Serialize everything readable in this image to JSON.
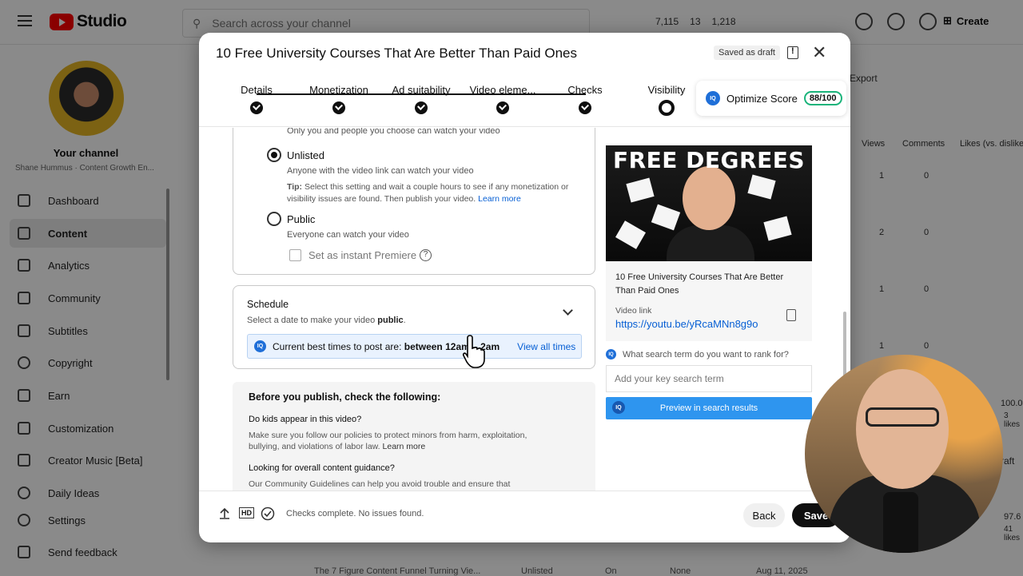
{
  "header": {
    "logo_text": "Studio",
    "search_placeholder": "Search across your channel",
    "stat_views": "7,115",
    "stat_subs": "13",
    "stat_watch": "1,218",
    "create_label": "Create"
  },
  "sidebar": {
    "channel_title": "Your channel",
    "channel_subtitle": "Shane Hummus · Content Growth En...",
    "items": [
      {
        "label": "Dashboard"
      },
      {
        "label": "Content"
      },
      {
        "label": "Analytics"
      },
      {
        "label": "Community"
      },
      {
        "label": "Subtitles"
      },
      {
        "label": "Copyright"
      },
      {
        "label": "Earn"
      },
      {
        "label": "Customization"
      },
      {
        "label": "Creator Music [Beta]"
      },
      {
        "label": "Daily Ideas"
      },
      {
        "label": "Settings"
      },
      {
        "label": "Send feedback"
      }
    ]
  },
  "background": {
    "export_label": "Export",
    "col_views": "Views",
    "col_comments": "Comments",
    "col_likes": "Likes (vs. dislikes)",
    "row_values": [
      "1",
      "0",
      "2",
      "0",
      "1",
      "0",
      "1",
      "0"
    ],
    "pct_1": "100.0",
    "likes_1": "3 likes",
    "draft": "raft",
    "pct_2": "97.6",
    "likes_2": "41 likes",
    "bottom_row_title": "The 7 Figure Content Funnel Turning Vie...",
    "bottom_row_visibility": "Unlisted",
    "bottom_row_on": "On",
    "bottom_row_none": "None",
    "bottom_row_date": "Aug 11, 2025"
  },
  "modal": {
    "title": "10 Free University Courses That Are Better Than Paid Ones",
    "draft_badge": "Saved as draft",
    "steps": [
      {
        "label": "Details"
      },
      {
        "label": "Monetization"
      },
      {
        "label": "Ad suitability"
      },
      {
        "label": "Video eleme..."
      },
      {
        "label": "Checks"
      },
      {
        "label": "Visibility"
      }
    ],
    "optimize_label": "Optimize Score",
    "optimize_value": "88/100",
    "visibility": {
      "private_desc": "Only you and people you choose can watch your video",
      "unlisted_label": "Unlisted",
      "unlisted_desc": "Anyone with the video link can watch your video",
      "tip_bold": "Tip:",
      "tip_text": " Select this setting and wait a couple hours to see if any monetization or visibility issues are found. Then publish your video. ",
      "learn_more": "Learn more",
      "public_label": "Public",
      "public_desc": "Everyone can watch your video",
      "premiere_label": "Set as instant Premiere"
    },
    "schedule": {
      "title": "Schedule",
      "desc_prefix": "Select a date to make your video ",
      "desc_bold": "public",
      "desc_suffix": ".",
      "best_prefix": "Current best times to post are: ",
      "best_times": "between 12am – 2am",
      "view_all": "View all times"
    },
    "publish_check": {
      "title": "Before you publish, check the following:",
      "q1": "Do kids appear in this video?",
      "q1_desc": "Make sure you follow our policies to protect minors from harm, exploitation, bullying, and violations of labor law. ",
      "q1_link": "Learn more",
      "q2": "Looking for overall content guidance?",
      "q2_desc": "Our Community Guidelines can help you avoid trouble and ensure that"
    },
    "preview": {
      "thumb_title": "FREE DEGREES",
      "video_title": "10 Free University Courses That Are Better Than Paid Ones",
      "video_link_label": "Video link",
      "video_link": "https://youtu.be/yRcaMNn8g9o",
      "rank_question": "What search term do you want to rank for?",
      "key_placeholder": "Add your key search term",
      "preview_button": "Preview in search results"
    },
    "footer": {
      "status": "Checks complete. No issues found.",
      "hd_label": "HD",
      "back": "Back",
      "save": "Save"
    }
  }
}
